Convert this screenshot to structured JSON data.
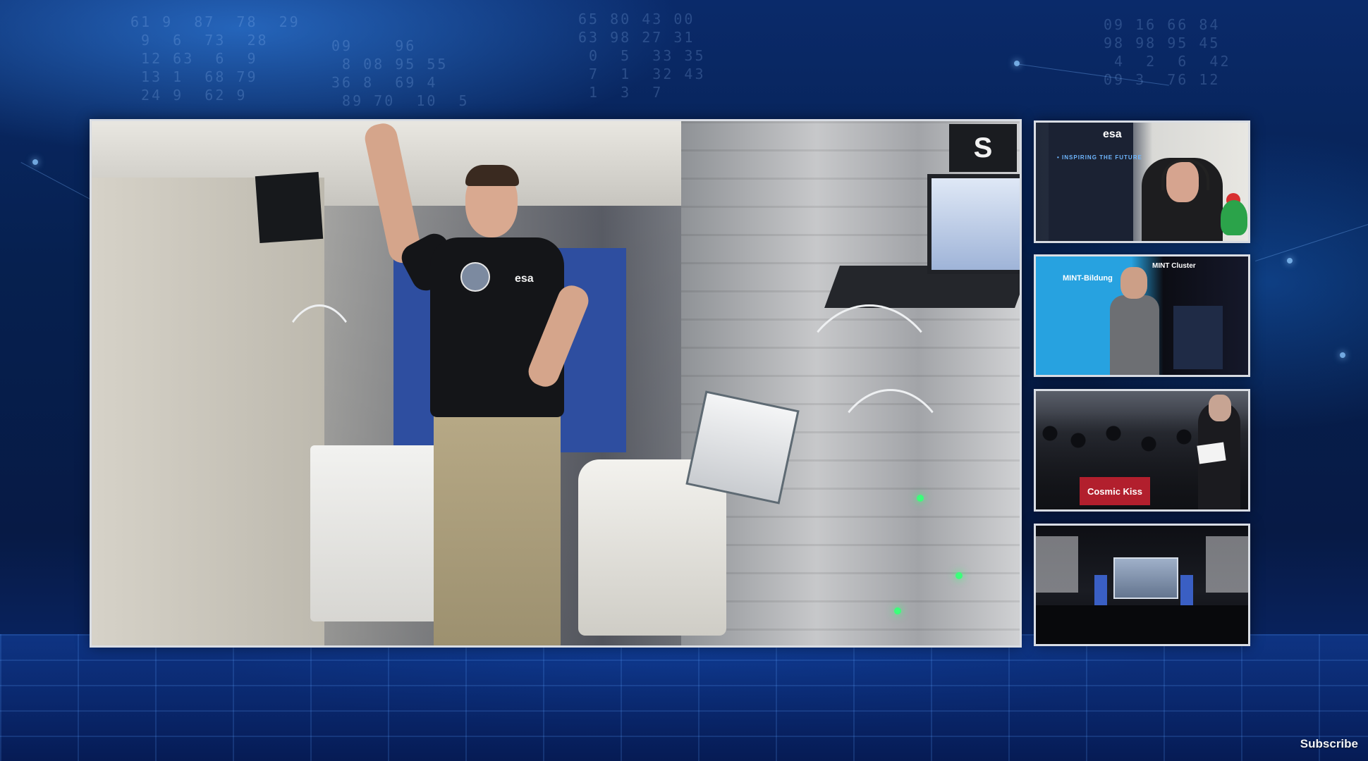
{
  "background": {
    "accent_color": "#1e5bd6",
    "digits": [
      "61 9  87  78  29\n 9  6  73  28\n 12 63  6  9\n 13 1  68 79\n 24 9  62 9",
      "09    96\n 8 08 95 55\n36 8  69 4\n 89 70  10  5",
      "65 80 43 00\n63 98 27 31\n 0  5  33 35\n 7  1  32 43\n 1  3  7",
      "09 16 66 84\n98 98 95 45\n 4  2  6  42\n09 3  76 12"
    ]
  },
  "main_feed": {
    "banner_text": "esa",
    "chest_logo": "esa",
    "corner_badge": "S"
  },
  "thumbnails": [
    {
      "poster_brand": "esa",
      "poster_line": "• INSPIRING THE FUTURE"
    },
    {
      "sign_text": "MINT-Bildung",
      "banner_text": "MINT Cluster"
    },
    {
      "banner_text": "Cosmic Kiss"
    },
    {}
  ],
  "overlay": {
    "subscribe_label": "Subscribe"
  }
}
